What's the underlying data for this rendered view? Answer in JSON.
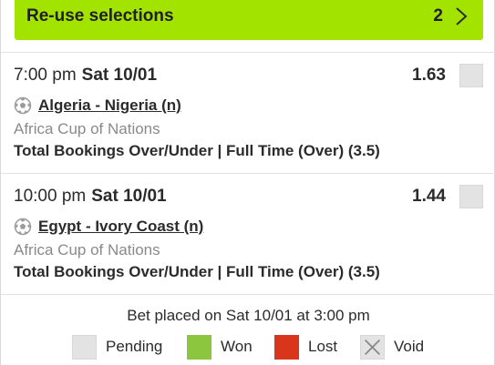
{
  "reuse": {
    "label": "Re-use selections",
    "count": "2"
  },
  "selections": [
    {
      "time": "7:00 pm",
      "date": "Sat 10/01",
      "odds": "1.63",
      "match": "Algeria - Nigeria (n)",
      "competition": "Africa Cup of Nations",
      "market": "Total Bookings Over/Under | Full Time (Over) (3.5)",
      "status_color": "#e3e3e3"
    },
    {
      "time": "10:00 pm",
      "date": "Sat 10/01",
      "odds": "1.44",
      "match": "Egypt - Ivory Coast (n)",
      "competition": "Africa Cup of Nations",
      "market": "Total Bookings Over/Under | Full Time (Over) (3.5)",
      "status_color": "#e3e3e3"
    }
  ],
  "bet_placed": "Bet placed on Sat 10/01 at 3:00 pm",
  "legend": [
    {
      "label": "Pending",
      "color": "#e3e3e3"
    },
    {
      "label": "Won",
      "color": "#8cc63f"
    },
    {
      "label": "Lost",
      "color": "#d9341c"
    },
    {
      "label": "Void",
      "color": "#e3e3e3",
      "icon": "x-icon"
    }
  ],
  "colors": {
    "accent": "#a3e300"
  }
}
